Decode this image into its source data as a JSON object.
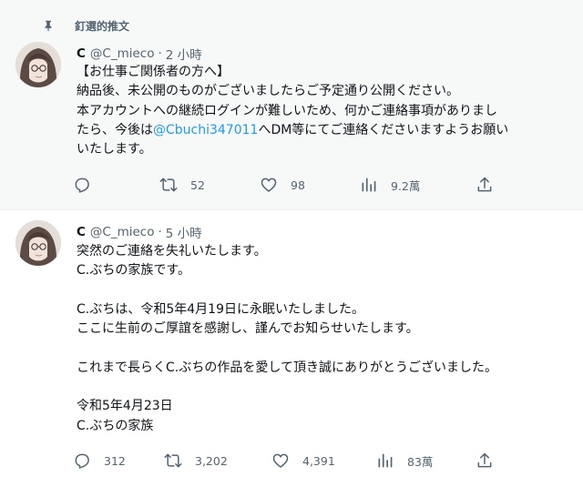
{
  "pinned_label": "釘選的推文",
  "colors": {
    "link": "#1d9bf0",
    "secondary": "#536471",
    "pinned_bg": "#f7f9f9"
  },
  "tweets": [
    {
      "name": "C",
      "handle": "@C_mieco",
      "dot": "·",
      "time": "2 小時",
      "lines": [
        "【お仕事ご関係者の方へ】",
        "納品後、未公開のものがございましたらご予定通り公開ください。",
        "本アカウントへの継続ログインが難しいため、何かご連絡事項がありまし",
        "",
        "いたします。"
      ],
      "line4_pre": "たら、今後は",
      "line4_link": "@Cbuchi347011",
      "line4_post": "へDM等にてご連絡くださいますようお願い",
      "actions": {
        "reply": "",
        "retweet": "52",
        "like": "98",
        "views": "9.2萬"
      }
    },
    {
      "name": "C",
      "handle": "@C_mieco",
      "dot": "·",
      "time": "5 小時",
      "lines": [
        "突然のご連絡を失礼いたします。",
        "C.ぶちの家族です。",
        "",
        "C.ぶちは、令和5年4月19日に永眠いたしました。",
        "ここに生前のご厚誼を感謝し、謹んでお知らせいたします。",
        "",
        "これまで長らくC.ぶちの作品を愛して頂き誠にありがとうございました。",
        "",
        "令和5年4月23日",
        "C.ぶちの家族"
      ],
      "actions": {
        "reply": "312",
        "retweet": "3,202",
        "like": "4,391",
        "views": "83萬"
      }
    }
  ]
}
